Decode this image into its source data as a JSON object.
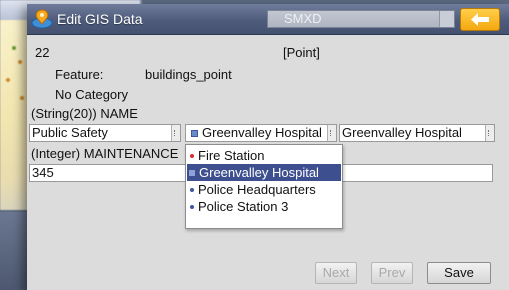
{
  "window": {
    "title": "Edit GIS Data",
    "layer_select": "SMXD",
    "back_icon": "back-arrow-icon",
    "accent_color": "#f4a80f",
    "titlebar_color": "#4e5b7b"
  },
  "record": {
    "id": "22",
    "geometry": "[Point]",
    "feature_label": "Feature:",
    "feature_value": "buildings_point",
    "category": "No Category"
  },
  "fields": [
    {
      "label": "(String(20)) NAME",
      "values": [
        "Public Safety",
        "Greenvalley Hospital",
        "Greenvalley Hospital"
      ]
    },
    {
      "label": "(Integer) MAINTENANCE",
      "value": "345"
    }
  ],
  "dropdown": {
    "options": [
      {
        "label": "Fire Station",
        "bullet_color": "#d22f2f",
        "selected": false
      },
      {
        "label": "Greenvalley Hospital",
        "bullet_color": "#8ea2d8",
        "selected": true
      },
      {
        "label": "Police Headquarters",
        "bullet_color": "#3a58a0",
        "selected": false
      },
      {
        "label": "Police Station 3",
        "bullet_color": "#3a58a0",
        "selected": false
      }
    ]
  },
  "buttons": {
    "next": "Next",
    "prev": "Prev",
    "save": "Save"
  }
}
